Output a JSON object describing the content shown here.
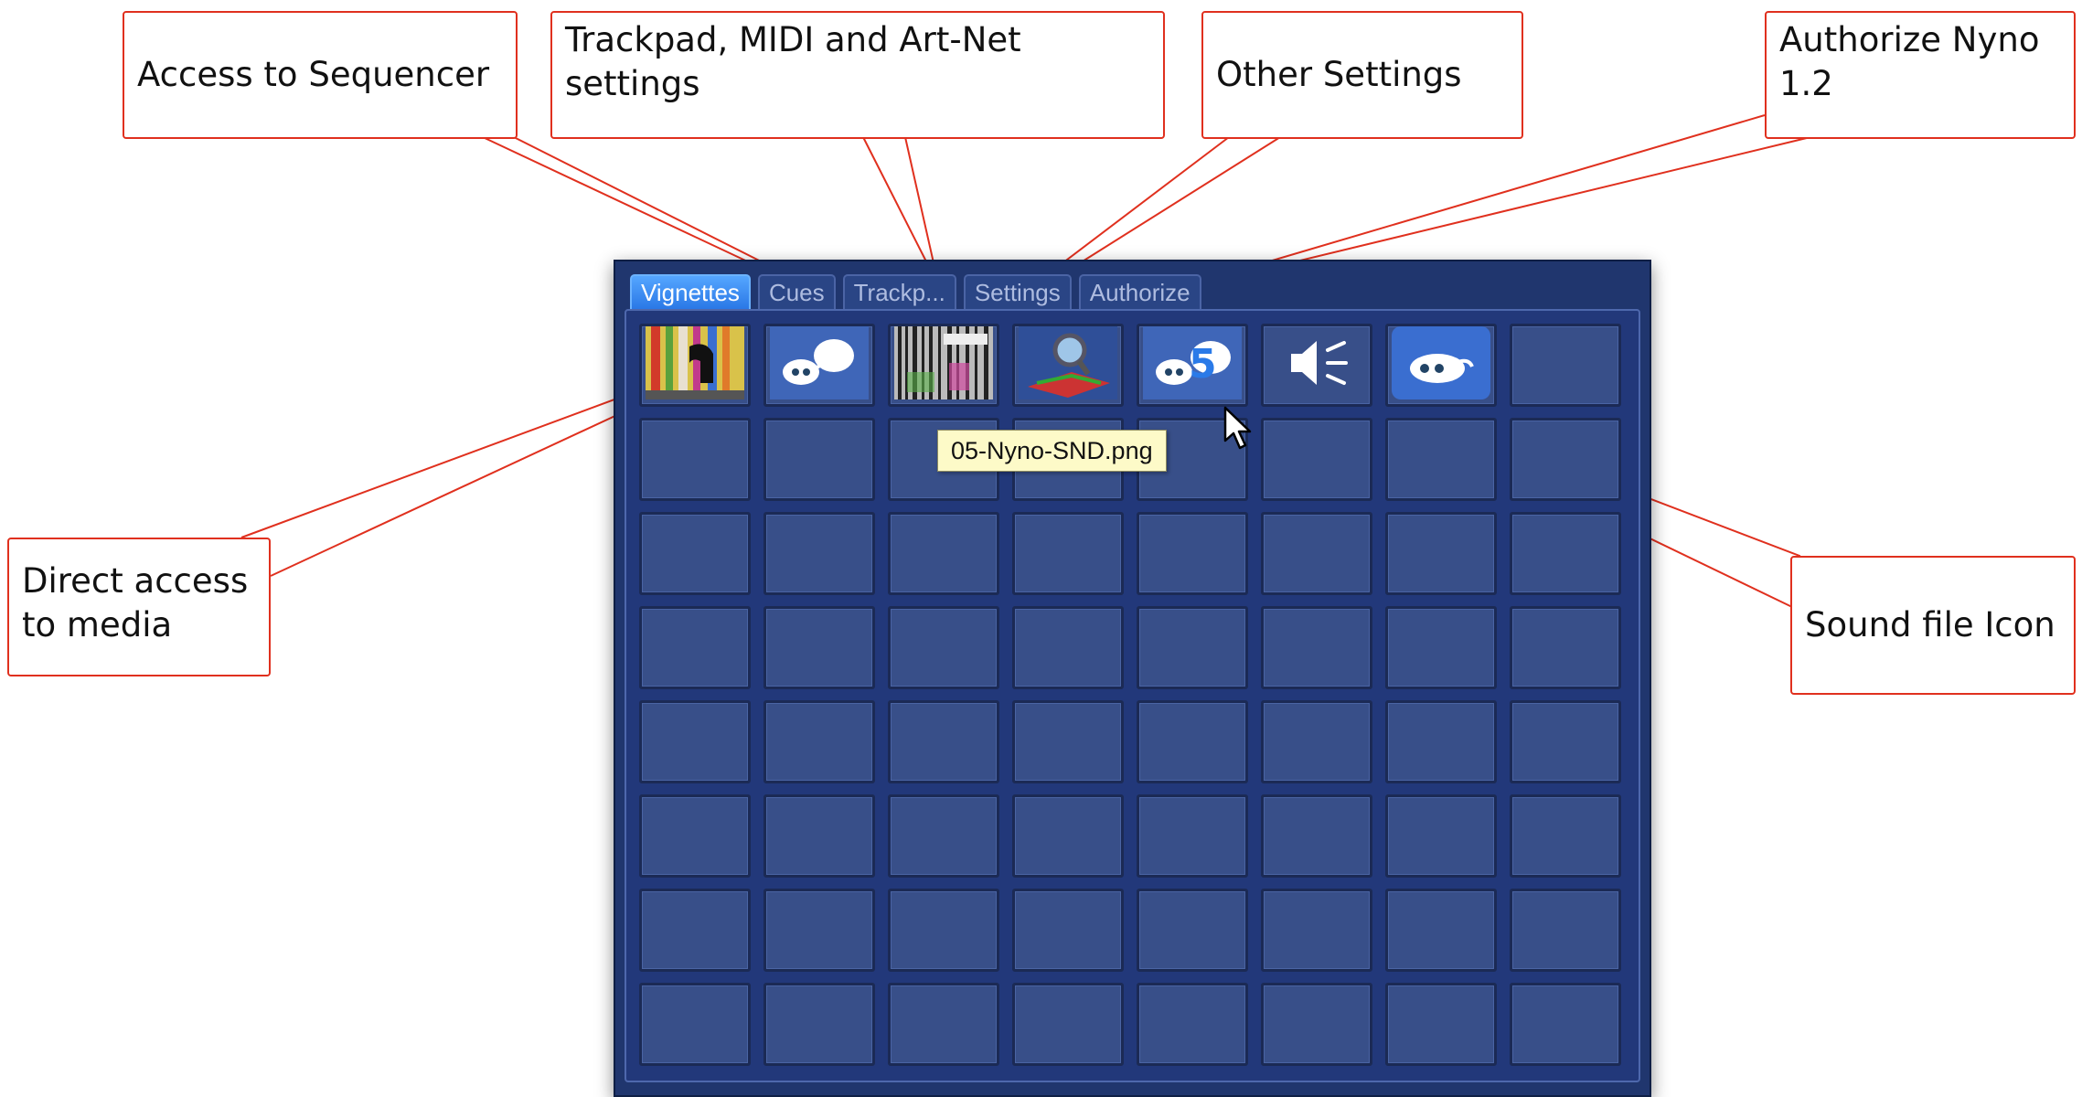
{
  "callouts": {
    "sequencer": "Access to Sequencer",
    "trackpad_line1": "Trackpad, MIDI and Art-Net",
    "trackpad_line2": "settings",
    "other_settings": "Other Settings",
    "authorize_line1": "Authorize Nyno",
    "authorize_line2": "1.2",
    "direct_line1": "Direct access",
    "direct_line2": "to media",
    "sound": "Sound file Icon"
  },
  "tabs": [
    {
      "label": "Vignettes",
      "active": true
    },
    {
      "label": "Cues"
    },
    {
      "label": "Trackp..."
    },
    {
      "label": "Settings"
    },
    {
      "label": "Authorize"
    }
  ],
  "grid": {
    "columns": 8,
    "rows": 8,
    "thumbnails": [
      {
        "icon": "striped-photo-thumbnail-icon"
      },
      {
        "icon": "nyno-mascot-thumbnail-icon"
      },
      {
        "icon": "barcode-photo-thumbnail-icon"
      },
      {
        "icon": "magnifier-map-thumbnail-icon"
      },
      {
        "icon": "nyno-mascot-5-thumbnail-icon"
      },
      {
        "icon": "speaker-sound-icon"
      },
      {
        "icon": "nyno-mascot-blue-thumbnail-icon"
      }
    ]
  },
  "tooltip": "05-Nyno-SND.png",
  "colors": {
    "callout_border": "#e0301e",
    "panel_bg": "#20366e",
    "tab_active": "#3c8cf5",
    "tooltip_bg": "#fdfac8"
  }
}
